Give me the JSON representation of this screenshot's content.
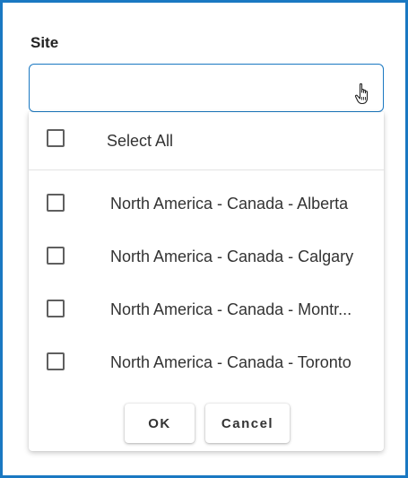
{
  "field": {
    "label": "Site",
    "value": ""
  },
  "dropdown": {
    "select_all_label": "Select All",
    "options": [
      {
        "label": "North America - Canada - Alberta",
        "checked": false
      },
      {
        "label": "North America - Canada - Calgary",
        "checked": false
      },
      {
        "label": "North America - Canada - Montr...",
        "checked": false
      },
      {
        "label": "North America - Canada - Toronto",
        "checked": false
      }
    ],
    "ok_label": "OK",
    "cancel_label": "Cancel"
  },
  "colors": {
    "accent": "#1a78c2",
    "checkbox_border": "#5f5f5f",
    "text": "#333333"
  },
  "icons": {
    "cursor": "hand-pointer-icon"
  }
}
